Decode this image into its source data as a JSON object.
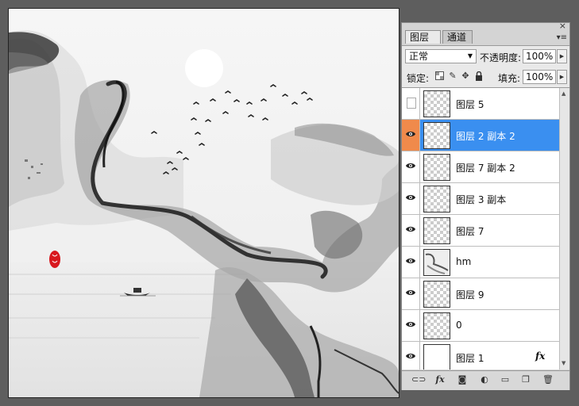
{
  "panel": {
    "tabs": [
      {
        "label": "图层",
        "close": "×"
      },
      {
        "label": "通道"
      }
    ],
    "close_glyph": "×",
    "menu_glyph": "▾≡",
    "blend_mode": "正常",
    "opacity_label": "不透明度:",
    "opacity_value": "100%",
    "lock_label": "锁定:",
    "fill_label": "填充:",
    "fill_value": "100%",
    "layers": [
      {
        "name": "图层 5",
        "visible": false,
        "thumb": "checker"
      },
      {
        "name": "图层 2 副本 2",
        "visible": true,
        "selected": true,
        "thumb": "checker"
      },
      {
        "name": "图层 7 副本 2",
        "visible": true,
        "thumb": "checker"
      },
      {
        "name": "图层 3 副本",
        "visible": true,
        "thumb": "checker"
      },
      {
        "name": "图层 7",
        "visible": true,
        "thumb": "checker"
      },
      {
        "name": "hm",
        "visible": true,
        "thumb": "hm"
      },
      {
        "name": "图层 9",
        "visible": true,
        "thumb": "checker"
      },
      {
        "name": "0",
        "visible": true,
        "thumb": "checker"
      },
      {
        "name": "图层 1",
        "visible": true,
        "thumb": "white",
        "fx": "fx"
      }
    ],
    "footer_icons": [
      "link-icon",
      "fx-icon",
      "mask-icon",
      "adjustment-icon",
      "group-folder-icon",
      "new-layer-icon",
      "trash-icon"
    ]
  },
  "colors": {
    "selection": "#3a8ff0",
    "eye_selected": "#f08a4b",
    "seal": "#d8181e"
  }
}
